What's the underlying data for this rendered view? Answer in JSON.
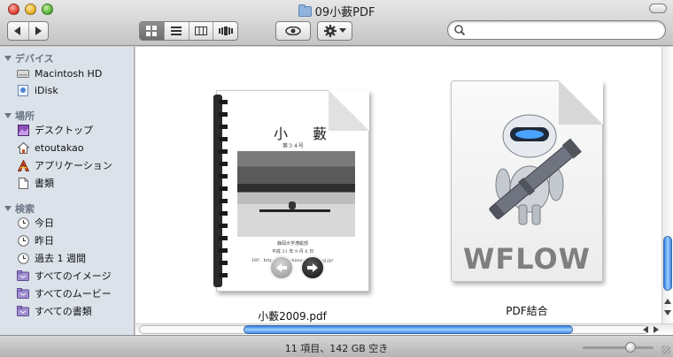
{
  "window": {
    "title": "09小藪PDF"
  },
  "search": {
    "value": "",
    "placeholder": ""
  },
  "sidebar": {
    "sections": [
      {
        "header": "デバイス",
        "items": [
          {
            "label": "Macintosh HD",
            "icon": "hard-drive-icon"
          },
          {
            "label": "iDisk",
            "icon": "idisk-icon"
          }
        ]
      },
      {
        "header": "場所",
        "items": [
          {
            "label": "デスクトップ",
            "icon": "desktop-icon"
          },
          {
            "label": "etoutakao",
            "icon": "home-icon"
          },
          {
            "label": "アプリケーション",
            "icon": "applications-icon"
          },
          {
            "label": "書類",
            "icon": "documents-icon"
          }
        ]
      },
      {
        "header": "検索",
        "items": [
          {
            "label": "今日",
            "icon": "clock-icon"
          },
          {
            "label": "昨日",
            "icon": "clock-icon"
          },
          {
            "label": "過去 1 週間",
            "icon": "clock-icon"
          },
          {
            "label": "すべてのイメージ",
            "icon": "smart-folder-icon"
          },
          {
            "label": "すべてのムービー",
            "icon": "smart-folder-icon"
          },
          {
            "label": "すべての書類",
            "icon": "smart-folder-icon"
          }
        ]
      }
    ]
  },
  "files": [
    {
      "name": "小藪2009.pdf",
      "thumbnail": {
        "title": "小　藪",
        "subtitle": "第３４号",
        "publisher": "静岡大学漕艇部",
        "date": "平成 21 年 9 月 6 日",
        "url": "HP：http://www.shizuoka-rowing.jp/"
      }
    },
    {
      "name": "PDF結合",
      "icon_text": "WFLOW"
    }
  ],
  "status": {
    "text": "11 項目、142 GB 空き"
  },
  "colors": {
    "sidebar_bg": "#dbe2ea",
    "scroll_accent": "#3e8ae6"
  }
}
